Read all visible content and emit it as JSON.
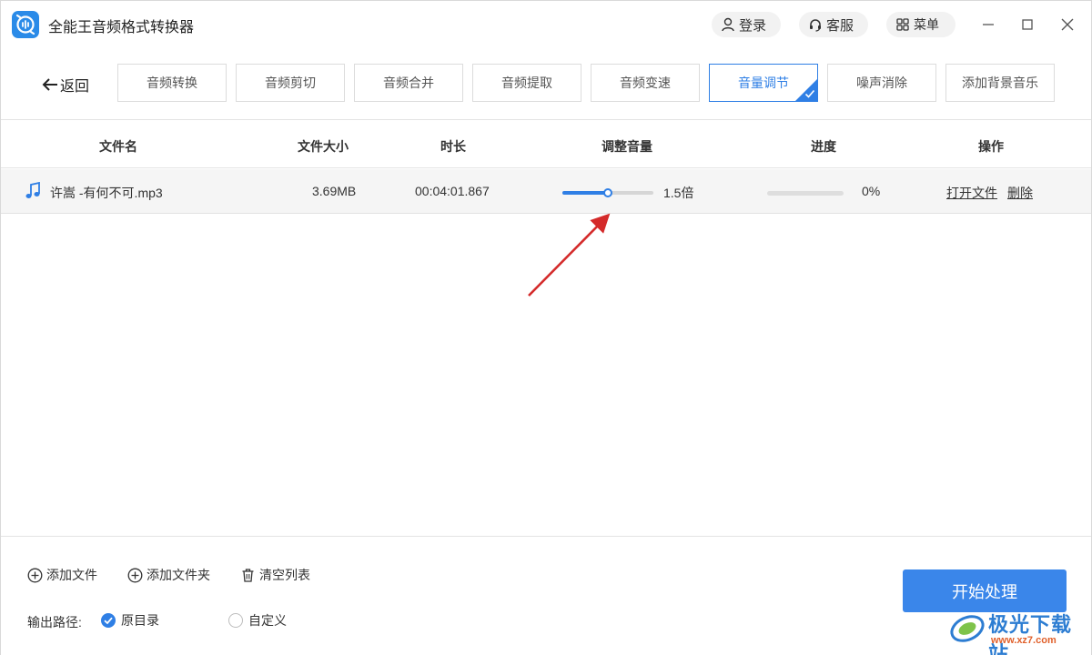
{
  "app": {
    "title": "全能王音频格式转换器"
  },
  "titlebar": {
    "login": "登录",
    "service": "客服",
    "menu": "菜单"
  },
  "toolbar": {
    "back": "返回",
    "tabs": [
      "音频转换",
      "音频剪切",
      "音频合并",
      "音频提取",
      "音频变速",
      "音量调节",
      "噪声消除",
      "添加背景音乐"
    ],
    "active_tab": "音量调节"
  },
  "table": {
    "headers": [
      "文件名",
      "文件大小",
      "时长",
      "调整音量",
      "进度",
      "操作"
    ],
    "rows": [
      {
        "name": "许嵩 -有何不可.mp3",
        "size": "3.69MB",
        "duration": "00:04:01.867",
        "volume_label": "1.5倍",
        "volume_fraction": 0.5,
        "progress_label": "0%",
        "progress_fraction": 0,
        "open_file": "打开文件",
        "delete": "删除"
      }
    ]
  },
  "bottom": {
    "add_file": "添加文件",
    "add_folder": "添加文件夹",
    "clear_list": "清空列表",
    "output_label": "输出路径:",
    "option_original": "原目录",
    "option_custom": "自定义",
    "start": "开始处理"
  },
  "watermark": {
    "name": "极光下载站",
    "url": "www.xz7.com"
  },
  "colors": {
    "accent": "#2f7fe5",
    "annotation": "#d42a2a"
  },
  "icons": [
    "app-logo-icon",
    "user-icon",
    "headset-icon",
    "grid-icon",
    "minimize-icon",
    "maximize-icon",
    "close-icon",
    "back-arrow-icon",
    "check-icon",
    "music-note-icon",
    "plus-circle-icon",
    "trash-icon"
  ]
}
